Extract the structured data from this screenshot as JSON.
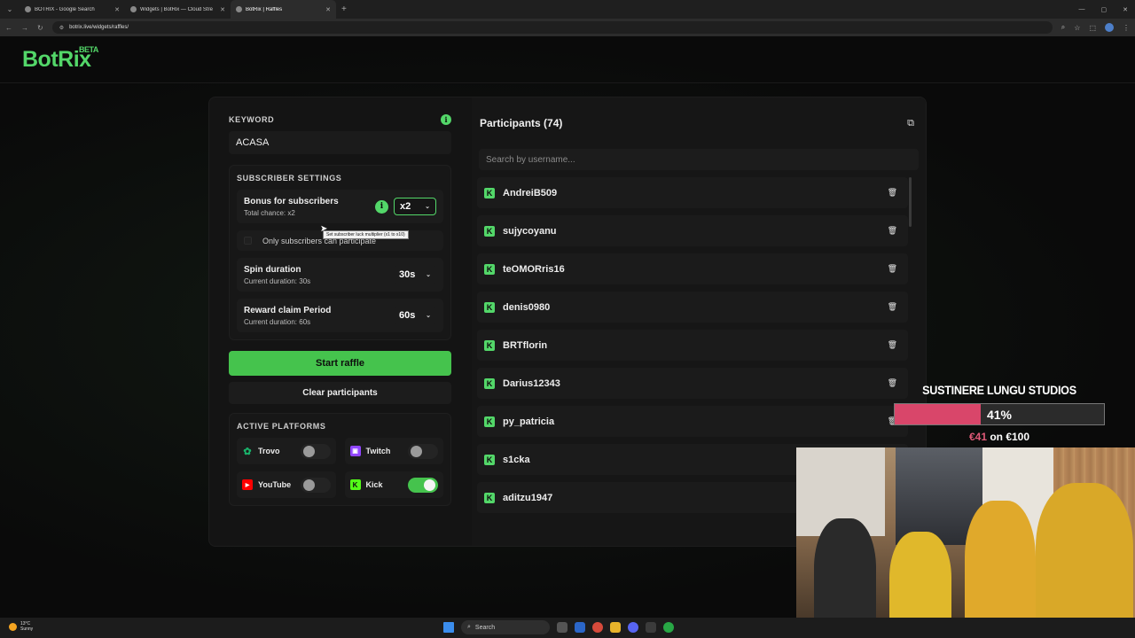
{
  "browser": {
    "tabs": [
      {
        "title": "BOTRIX - Google Search"
      },
      {
        "title": "Widgets | BotRix — Cloud Stre"
      },
      {
        "title": "BotRix | Raffles"
      }
    ],
    "active_tab": 2,
    "url": "botrix.live/widgets/raffles/"
  },
  "header": {
    "logo": "BotRix",
    "beta": "BETA"
  },
  "keyword": {
    "label": "KEYWORD",
    "value": "ACASA"
  },
  "subscriber_settings": {
    "label": "SUBSCRIBER SETTINGS",
    "bonus_title": "Bonus for subscribers",
    "bonus_sub": "Total chance: x2",
    "bonus_value": "x2",
    "tooltip": "Set subscriber luck multiplier (x1 to x10)",
    "only_subs_label": "Only subscribers can participate",
    "spin_title": "Spin duration",
    "spin_sub": "Current duration: 30s",
    "spin_value": "30s",
    "claim_title": "Reward claim Period",
    "claim_sub": "Current duration: 60s",
    "claim_value": "60s"
  },
  "buttons": {
    "start": "Start raffle",
    "clear": "Clear participants"
  },
  "platforms": {
    "label": "ACTIVE PLATFORMS",
    "items": [
      {
        "name": "Trovo",
        "enabled": false,
        "color": "#19b36b"
      },
      {
        "name": "Twitch",
        "enabled": false,
        "color": "#9146ff"
      },
      {
        "name": "YouTube",
        "enabled": false,
        "color": "#ff0000"
      },
      {
        "name": "Kick",
        "enabled": true,
        "color": "#53fc18"
      }
    ]
  },
  "participants": {
    "title": "Participants (74)",
    "search_placeholder": "Search by username...",
    "list": [
      "AndreiB509",
      "sujycoyanu",
      "teOMORris16",
      "denis0980",
      "BRTflorin",
      "Darius12343",
      "py_patricia",
      "s1cka",
      "aditzu1947"
    ]
  },
  "overlay": {
    "title": "SUSTINERE LUNGU STUDIOS",
    "percent_text": "41%",
    "progress": 0.41,
    "raised": "€41",
    "goal_text": " on €100"
  },
  "taskbar": {
    "temp": "13°C",
    "weather": "Sunny",
    "search": "Search"
  },
  "colors": {
    "accent": "#53d769",
    "start_button": "#45c34d",
    "overlay_fill": "#d9466a"
  }
}
